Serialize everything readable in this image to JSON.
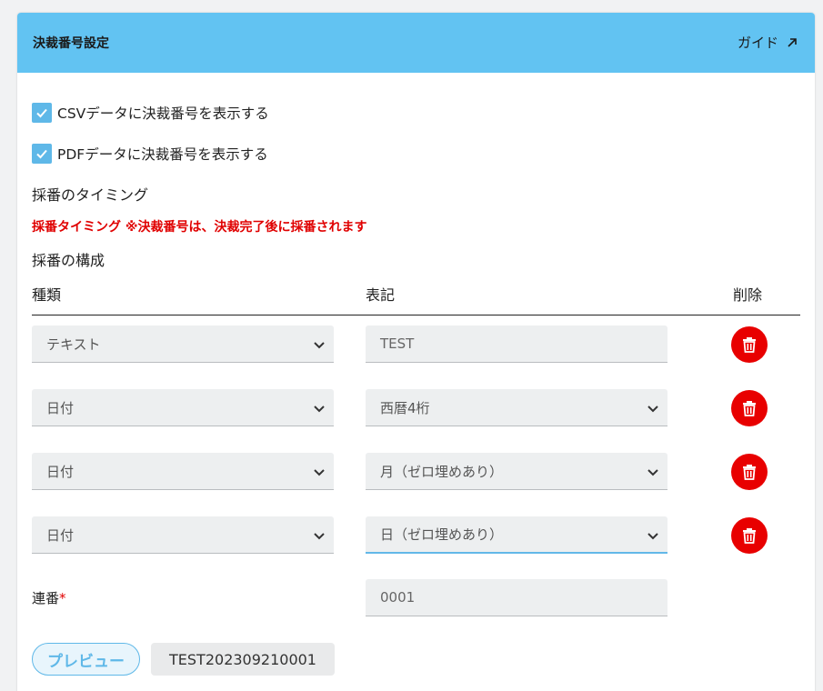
{
  "header": {
    "title": "決裁番号設定",
    "guide_label": "ガイド"
  },
  "options": {
    "csv_label": "CSVデータに決裁番号を表示する",
    "csv_checked": true,
    "pdf_label": "PDFデータに決裁番号を表示する",
    "pdf_checked": true
  },
  "timing": {
    "title": "採番のタイミング",
    "notice": "採番タイミング ※決裁番号は、決裁完了後に採番されます"
  },
  "composition": {
    "title": "採番の構成",
    "col_type": "種類",
    "col_format": "表記",
    "col_delete": "削除",
    "rows": [
      {
        "type": "テキスト",
        "format": "TEST",
        "format_kind": "text"
      },
      {
        "type": "日付",
        "format": "西暦4桁",
        "format_kind": "select"
      },
      {
        "type": "日付",
        "format": "月（ゼロ埋めあり）",
        "format_kind": "select"
      },
      {
        "type": "日付",
        "format": "日（ゼロ埋めあり）",
        "format_kind": "select"
      }
    ]
  },
  "serial": {
    "label": "連番",
    "required_mark": "*",
    "value": "0001"
  },
  "preview": {
    "button_label": "プレビュー",
    "value": "TEST202309210001"
  },
  "colors": {
    "header": "#62c3f2",
    "accent": "#5fb8e8",
    "danger": "#e80000",
    "warning_text": "#e00000"
  }
}
